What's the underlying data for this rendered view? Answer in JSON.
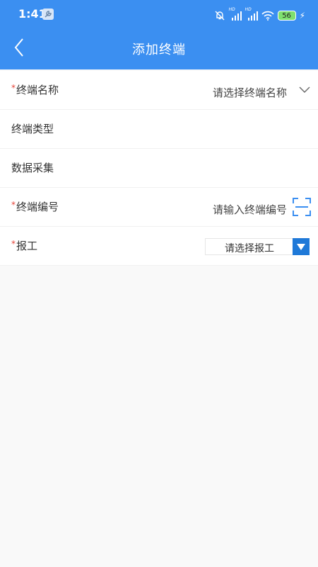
{
  "status_bar": {
    "time": "1:41",
    "battery": "56",
    "icons": [
      "wrench-icon",
      "mute-bell-icon",
      "signal-hd-icon",
      "signal-hd-icon",
      "wifi-icon",
      "battery-icon",
      "charging-icon"
    ]
  },
  "header": {
    "title": "添加终端",
    "back_icon": "back-chevron-icon"
  },
  "form": {
    "terminal_name": {
      "label": "终端名称",
      "required": true,
      "placeholder": "请选择终端名称"
    },
    "terminal_type": {
      "label": "终端类型",
      "required": false
    },
    "data_collection": {
      "label": "数据采集",
      "required": false
    },
    "terminal_code": {
      "label": "终端编号",
      "required": true,
      "placeholder": "请输入终端编号"
    },
    "report": {
      "label": "报工",
      "required": true,
      "placeholder": "请选择报工"
    }
  },
  "colors": {
    "header": "#3b8ff1",
    "required": "#e5453a",
    "select_button": "#1f79d8",
    "scan_icon": "#3b8ff1"
  }
}
